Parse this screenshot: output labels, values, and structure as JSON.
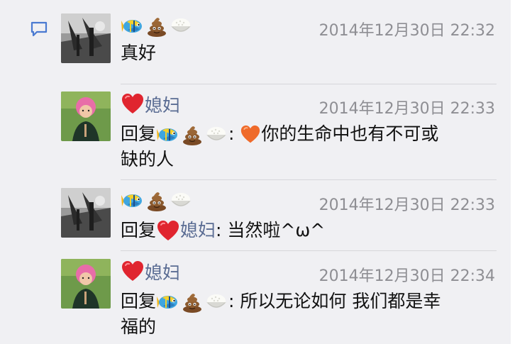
{
  "thread": {
    "comments": [
      {
        "author": "",
        "time": "2014年12月30日 22:32",
        "text": "真好"
      },
      {
        "author": "媳妇",
        "time": "2014年12月30日 22:33",
        "reply_prefix": "回复",
        "separator": ":",
        "text_line1": "你的生命中也有不可或",
        "text_line2": "缺的人"
      },
      {
        "author": "",
        "time": "2014年12月30日 22:33",
        "reply_prefix": "回复",
        "reply_to": "媳妇",
        "separator": ":",
        "text": "当然啦^ω^"
      },
      {
        "author": "媳妇",
        "time": "2014年12月30日 22:34",
        "reply_prefix": "回复",
        "separator": ":",
        "text_line1": "所以无论如何 我们都是幸",
        "text_line2": "福的"
      }
    ]
  },
  "icons": {
    "comment": "speech-bubble-icon",
    "fish": "tropical-fish-emoji",
    "poop": "pile-of-poo-emoji",
    "rice": "cooked-rice-emoji",
    "heart_red": "red-heart-emoji",
    "heart_orange": "orange-heart-emoji"
  },
  "colors": {
    "link": "#5a6c93",
    "icon_blue": "#4a7ad1",
    "background": "#f0f0f3",
    "timestamp": "#8e8e93"
  }
}
